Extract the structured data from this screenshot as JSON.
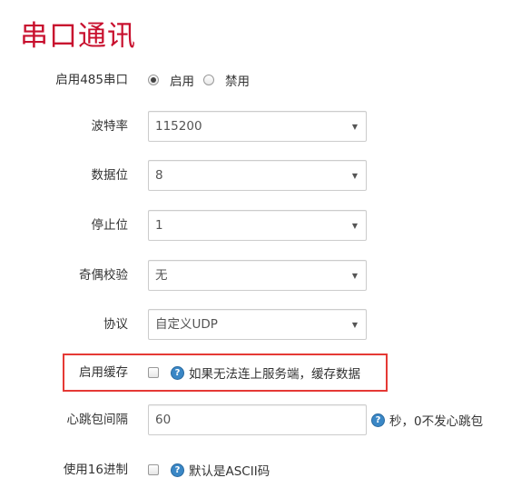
{
  "title": "串口通讯",
  "enable_485": {
    "label": "启用485串口",
    "options": [
      {
        "label": "启用",
        "checked": true
      },
      {
        "label": "禁用",
        "checked": false
      }
    ]
  },
  "baud_rate": {
    "label": "波特率",
    "value": "115200"
  },
  "data_bits": {
    "label": "数据位",
    "value": "8"
  },
  "stop_bits": {
    "label": "停止位",
    "value": "1"
  },
  "parity": {
    "label": "奇偶校验",
    "value": "无"
  },
  "protocol": {
    "label": "协议",
    "value": "自定义UDP"
  },
  "enable_cache": {
    "label": "启用缓存",
    "checked": false,
    "help_glyph": "?",
    "hint": "如果无法连上服务端，缓存数据"
  },
  "heartbeat": {
    "label": "心跳包间隔",
    "value": "60",
    "help_glyph": "?",
    "hint": "秒，0不发心跳包"
  },
  "use_hex": {
    "label": "使用16进制",
    "checked": false,
    "help_glyph": "?",
    "hint": "默认是ASCII码"
  },
  "colors": {
    "title": "#c8102e",
    "highlight_border": "#e53935",
    "help_icon": "#3a87c6"
  },
  "icons": {
    "help": "question-circle-icon",
    "dropdown": "caret-down-icon"
  }
}
